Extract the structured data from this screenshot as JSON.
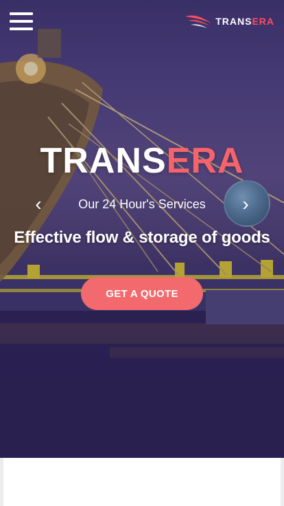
{
  "header": {
    "menu_icon": "hamburger-menu-icon",
    "logo": {
      "mark_icon": "swoosh-logo-icon",
      "text_main": "TRANS",
      "text_accent": "ERA",
      "accent_color": "#ff4d5e"
    }
  },
  "hero": {
    "brand_main": "TRANS",
    "brand_accent": "ERA",
    "brand_accent_color": "#f7636b",
    "services": "Our 24 Hour's Services",
    "tagline": "Effective flow & storage of goods",
    "cta_label": "GET A QUOTE",
    "cta_color": "#f26a6d",
    "prev_icon": "chevron-left-icon",
    "next_icon": "chevron-right-icon",
    "prev_glyph": "‹",
    "next_glyph": "›"
  },
  "colors": {
    "hero_overlay": "#3a3066",
    "page_bg": "#ededf0"
  }
}
